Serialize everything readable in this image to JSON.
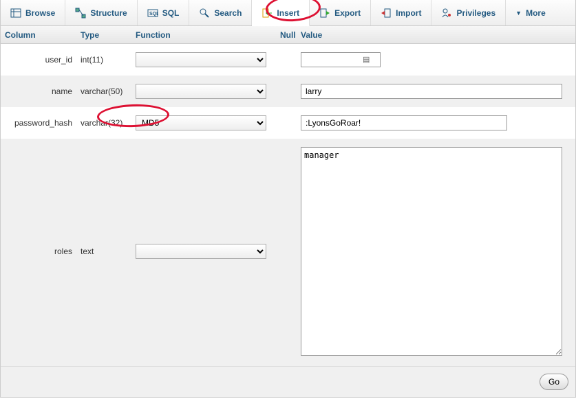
{
  "tabs": {
    "browse": "Browse",
    "structure": "Structure",
    "sql": "SQL",
    "search": "Search",
    "insert": "Insert",
    "export": "Export",
    "import": "Import",
    "privileges": "Privileges",
    "more": "More"
  },
  "headers": {
    "column": "Column",
    "type": "Type",
    "function": "Function",
    "null": "Null",
    "value": "Value"
  },
  "rows": {
    "user_id": {
      "column": "user_id",
      "type": "int(11)",
      "function": "",
      "value": ""
    },
    "name": {
      "column": "name",
      "type": "varchar(50)",
      "function": "",
      "value": "larry"
    },
    "password_hash": {
      "column": "password_hash",
      "type": "varchar(32)",
      "function": "MD5",
      "value": ":LyonsGoRoar!"
    },
    "roles": {
      "column": "roles",
      "type": "text",
      "function": "",
      "value": "manager"
    }
  },
  "footer": {
    "go": "Go"
  }
}
